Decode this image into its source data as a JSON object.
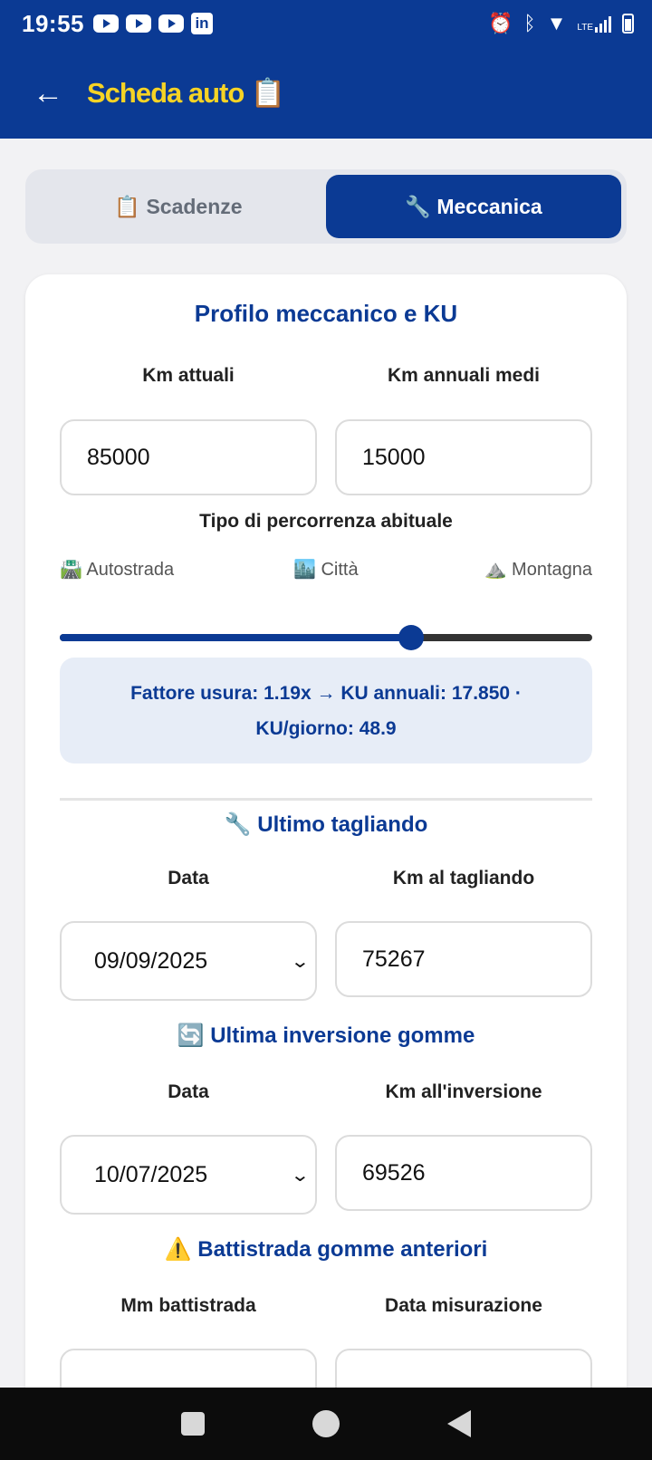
{
  "status_bar": {
    "time": "19:55",
    "notification_icons": [
      "youtube-icon",
      "youtube-icon",
      "youtube-icon",
      "linkedin-icon"
    ],
    "lte_label": "LTE"
  },
  "app_bar": {
    "back_glyph": "←",
    "title": "Scheda auto 📋"
  },
  "tabs": [
    {
      "label": "📋 Scadenze",
      "active": false
    },
    {
      "label": "🔧 Meccanica",
      "active": true
    }
  ],
  "profile": {
    "title": "Profilo meccanico e KU",
    "km_current_label": "Km attuali",
    "km_current_value": "85000",
    "km_annual_label": "Km annuali medi",
    "km_annual_value": "15000",
    "usage_label": "Tipo di percorrenza abituale",
    "terrain_highway": "🛣️ Autostrada",
    "terrain_city": "🏙️ Città",
    "terrain_mountain": "⛰️ Montagna",
    "slider_fraction": 0.66,
    "info_line1": "Fattore usura: 1.19x → KU annuali: 17.850 ·",
    "info_line2": "KU/giorno: 48.9"
  },
  "service": {
    "title": "🔧 Ultimo tagliando",
    "date_label": "Data",
    "date_value": "09/09/2025",
    "km_label": "Km al tagliando",
    "km_value": "75267"
  },
  "rotation": {
    "title": "🔄 Ultima inversione gomme",
    "date_label": "Data",
    "date_value": "10/07/2025",
    "km_label": "Km all'inversione",
    "km_value": "69526"
  },
  "tread": {
    "title": "⚠️ Battistrada gomme anteriori",
    "mm_label": "Mm battistrada",
    "date_label": "Data misurazione"
  },
  "colors": {
    "primary": "#0b3a94",
    "title_yellow": "#f6d325",
    "info_bg": "#e7edf7"
  }
}
